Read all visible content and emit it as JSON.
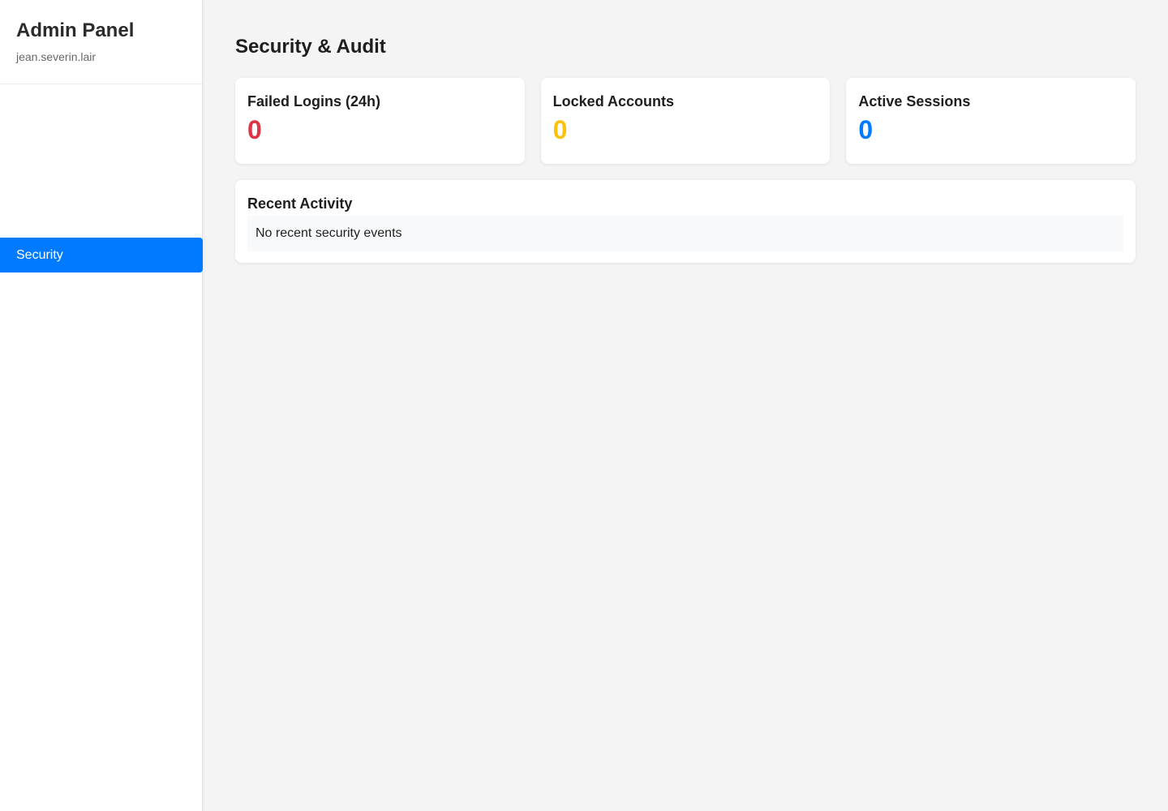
{
  "sidebar": {
    "title": "Admin Panel",
    "username": "jean.severin.lair",
    "items": [
      {
        "label": "Security",
        "active": true
      }
    ]
  },
  "main": {
    "page_title": "Security & Audit",
    "stats": [
      {
        "label": "Failed Logins (24h)",
        "value": "0",
        "color": "#dc3545"
      },
      {
        "label": "Locked Accounts",
        "value": "0",
        "color": "#ffc107"
      },
      {
        "label": "Active Sessions",
        "value": "0",
        "color": "#007bff"
      }
    ],
    "recent_activity": {
      "title": "Recent Activity",
      "empty_message": "No recent security events"
    }
  },
  "colors": {
    "accent": "#007bff",
    "danger": "#dc3545",
    "warning": "#ffc107"
  }
}
